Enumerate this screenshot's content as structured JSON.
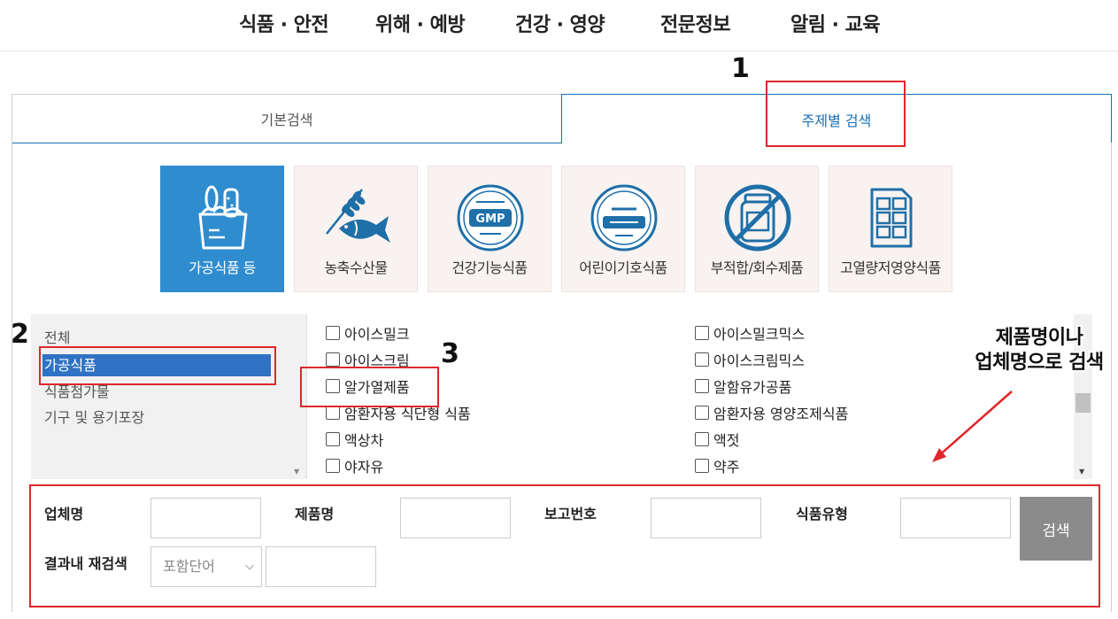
{
  "nav": {
    "items": [
      {
        "label": "식품 · 안전"
      },
      {
        "label": "위해 · 예방"
      },
      {
        "label": "건강 · 영양"
      },
      {
        "label": "전문정보"
      },
      {
        "label": "알림 · 교육"
      }
    ]
  },
  "tabs": {
    "basic_label": "기본검색",
    "topic_label": "주제별 검색",
    "active": "주제별 검색"
  },
  "categories": {
    "tiles": [
      {
        "label": "가공식품 등",
        "icon": "grocery-bag-icon"
      },
      {
        "label": "농축수산물",
        "icon": "fish-wheat-icon"
      },
      {
        "label": "건강기능식품",
        "icon": "gmp-seal-icon"
      },
      {
        "label": "어린이기호식품",
        "icon": "kids-food-seal-icon"
      },
      {
        "label": "부적합/회수제품",
        "icon": "prohibited-jar-icon"
      },
      {
        "label": "고열량저영양식품",
        "icon": "chocolate-bar-icon"
      }
    ],
    "active": "가공식품 등"
  },
  "category_list": {
    "items": [
      {
        "label": "전체"
      },
      {
        "label": "가공식품"
      },
      {
        "label": "식품첨가물"
      },
      {
        "label": "기구 및 용기포장"
      }
    ],
    "selected": "가공식품"
  },
  "food_types": {
    "left": [
      {
        "label": "아이스밀크"
      },
      {
        "label": "아이스크림"
      },
      {
        "label": "알가열제품"
      },
      {
        "label": "암환자용 식단형 식품"
      },
      {
        "label": "액상차"
      },
      {
        "label": "야자유"
      }
    ],
    "right": [
      {
        "label": "아이스밀크믹스"
      },
      {
        "label": "아이스크림믹스"
      },
      {
        "label": "알함유가공품"
      },
      {
        "label": "암환자용 영양조제식품"
      },
      {
        "label": "액젓"
      },
      {
        "label": "약주"
      }
    ]
  },
  "form": {
    "company_label": "업체명",
    "product_label": "제품명",
    "report_no_label": "보고번호",
    "food_type_label": "식품유형",
    "search_button": "검색",
    "research_label": "결과내 재검색",
    "research_select_value": "포함단어",
    "company_value": "",
    "product_value": "",
    "report_no_value": "",
    "food_type_value": "",
    "research_value": ""
  },
  "annotations": {
    "n1": "1",
    "n2": "2",
    "n3": "3",
    "note_line1": "제품명이나",
    "note_line2": "업체명으로 검색"
  },
  "colors": {
    "accent_blue": "#2f8ccf",
    "selected_blue": "#2f72c4",
    "annotation_red": "#e0262a",
    "button_gray": "#8b8b8b"
  }
}
